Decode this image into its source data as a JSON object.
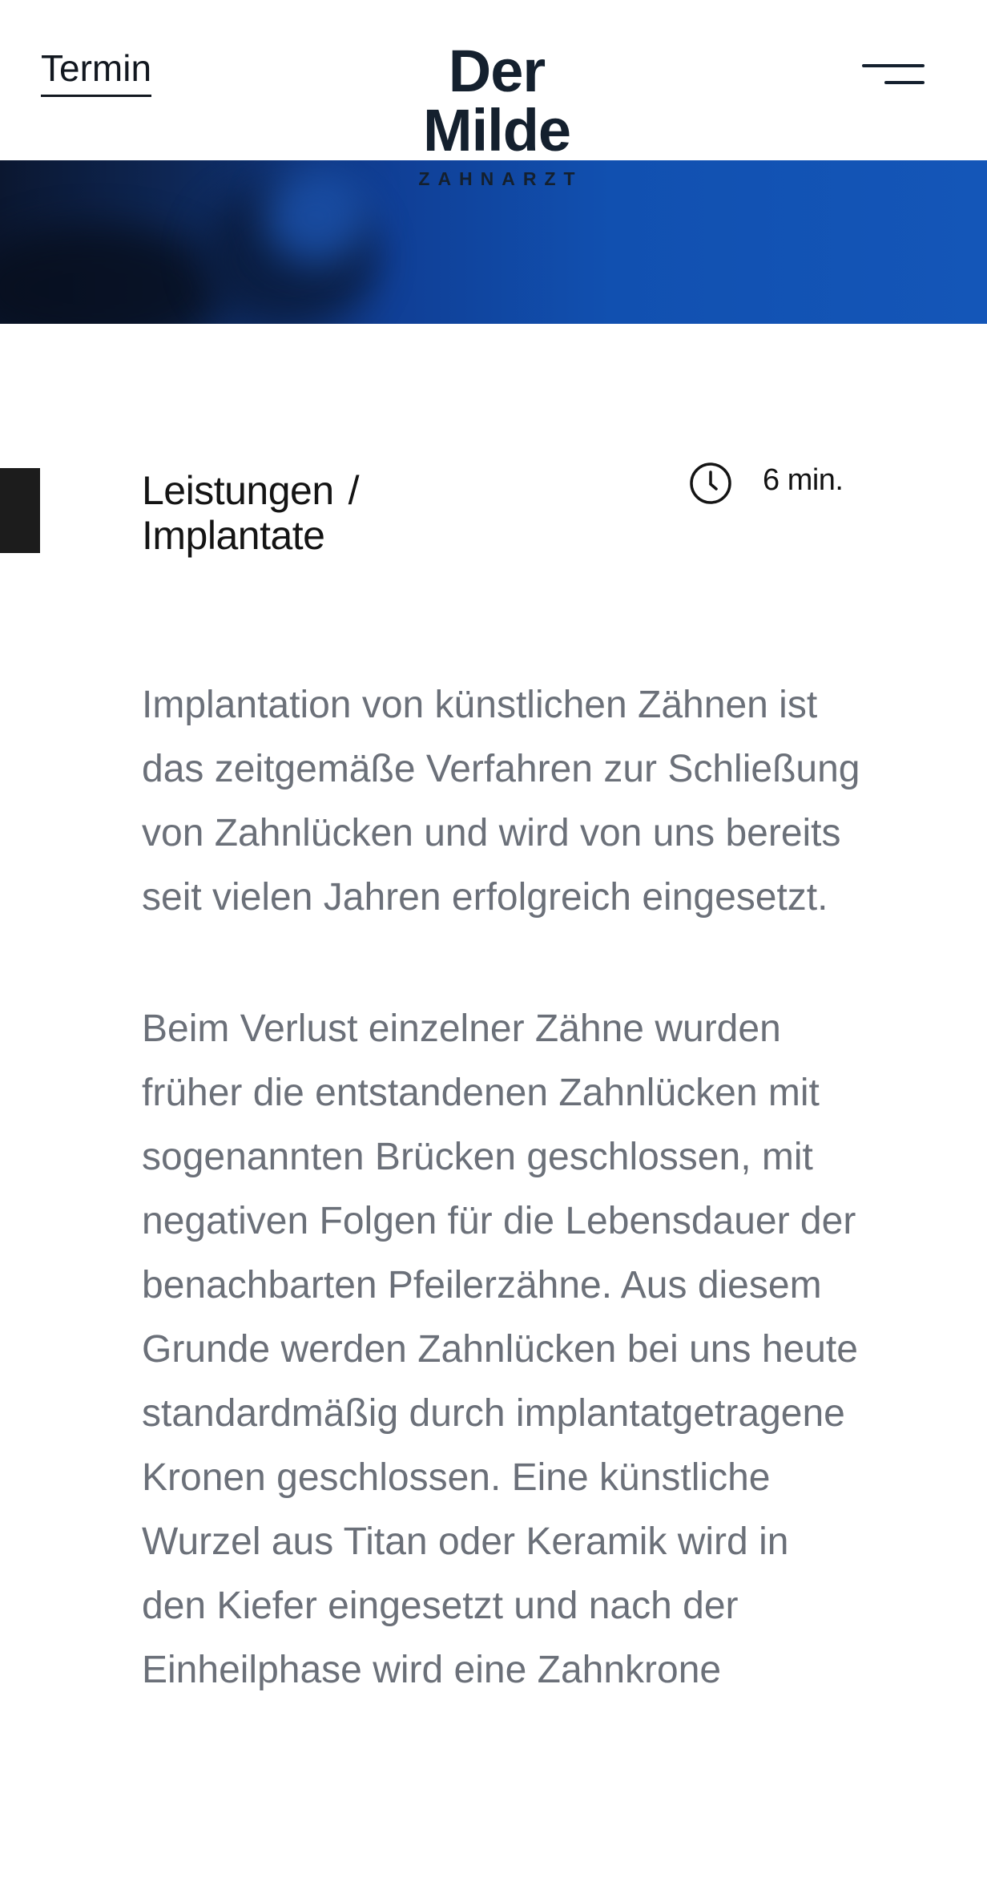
{
  "header": {
    "termin_label": "Termin",
    "logo_name": "Der Milde",
    "logo_subtitle": "ZAHNARZT",
    "menu_icon": "hamburger-menu-icon"
  },
  "hero": {
    "description_color": "#1150b0"
  },
  "breadcrumb": {
    "items": [
      {
        "label": "Leistungen"
      },
      {
        "label": "Implantate"
      }
    ],
    "separator": "/"
  },
  "reading_time": {
    "icon": "clock-icon",
    "label": "6 min."
  },
  "article": {
    "paragraphs": [
      "Implantation von künstlichen Zähnen ist das zeitgemäße Verfahren zur Schließung von Zahnlücken und wird von uns bereits seit vielen Jahren erfolgreich eingesetzt.",
      "Beim Verlust einzelner Zähne wurden früher die entstandenen Zahnlücken mit sogenannten Brücken geschlossen, mit negativen Folgen für die Lebensdauer der benachbarten Pfeilerzähne. Aus diesem Grunde werden Zahnlücken bei uns heute standardmäßig durch implantatgetragene Kronen geschlossen. Eine künstliche Wurzel aus Titan oder Keramik wird in den Kiefer eingesetzt und nach der Einheilphase wird eine Zahnkrone"
    ]
  },
  "colors": {
    "text_dark": "#14202e",
    "text_body": "#6b7079",
    "hero_blue": "#1456b8"
  }
}
